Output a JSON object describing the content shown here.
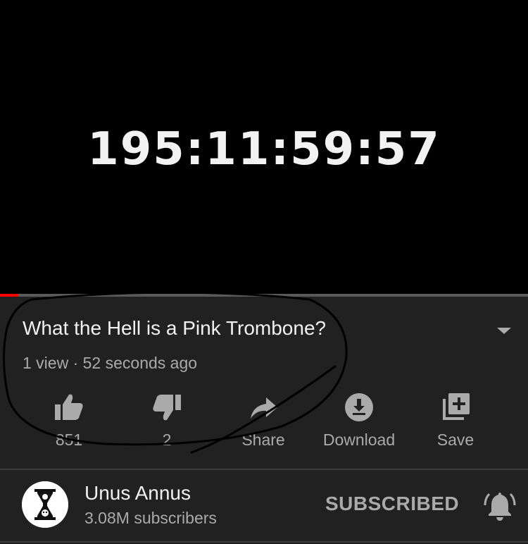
{
  "player": {
    "countdown": "195:11:59:57",
    "progress_fraction": 0.035,
    "progress_color": "#ff0000"
  },
  "video": {
    "title": "What the Hell is a Pink Trombone?",
    "meta": "1 view · 52 seconds ago",
    "expand_icon": "chevron-down-icon"
  },
  "actions": {
    "like": {
      "icon": "thumbs-up-icon",
      "label": "851"
    },
    "dislike": {
      "icon": "thumbs-down-icon",
      "label": "2"
    },
    "share": {
      "icon": "share-icon",
      "label": "Share"
    },
    "download": {
      "icon": "download-icon",
      "label": "Download"
    },
    "save": {
      "icon": "playlist-add-icon",
      "label": "Save"
    }
  },
  "channel": {
    "name": "Unus Annus",
    "subscribers": "3.08M subscribers",
    "avatar_icon": "hourglass-skull-icon",
    "subscribe_label": "SUBSCRIBED",
    "bell_icon": "notification-bell-icon"
  },
  "annotation": {
    "type": "hand-drawn circle",
    "color": "#000000"
  },
  "colors": {
    "background": "#212121",
    "text_primary": "#f1f1f1",
    "text_secondary": "#aaaaaa",
    "player_background": "#000000"
  }
}
